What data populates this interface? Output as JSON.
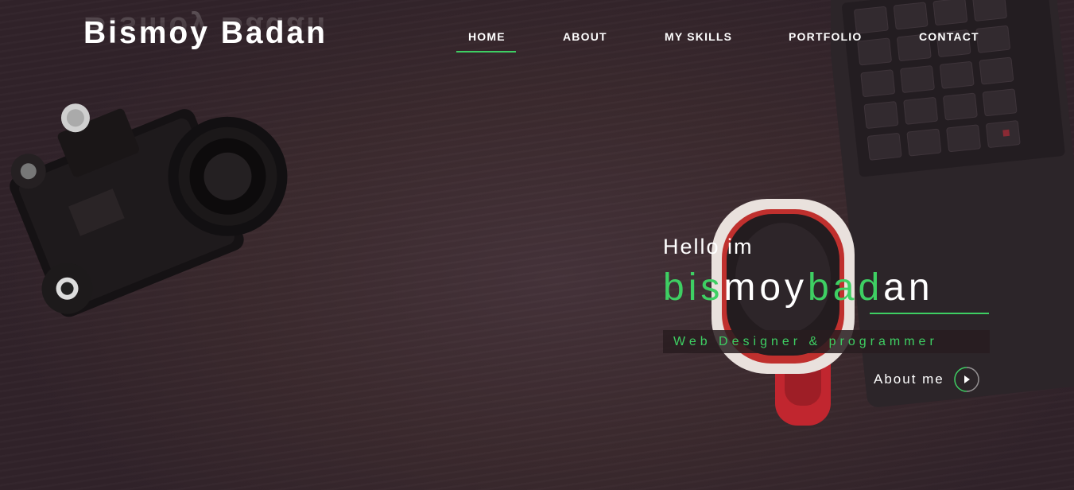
{
  "brand": {
    "name": "Bismoy Badan",
    "reflection": "Bismoy Badan"
  },
  "nav": {
    "items": [
      {
        "label": "HOME",
        "active": true
      },
      {
        "label": "ABOUT",
        "active": false
      },
      {
        "label": "MY SKILLS",
        "active": false
      },
      {
        "label": "PORTFOLIO",
        "active": false
      },
      {
        "label": "CONTACT",
        "active": false
      }
    ]
  },
  "hero": {
    "greeting": "Hello im",
    "name_parts": [
      {
        "text": "bis",
        "color": "green"
      },
      {
        "text": "moy",
        "color": "white"
      },
      {
        "text": "bad",
        "color": "green"
      },
      {
        "text": "an",
        "color": "white"
      }
    ],
    "role": "Web Designer & programmer",
    "cta_label": "About me",
    "cta_icon": "play-arrow-icon"
  },
  "colors": {
    "accent": "#3ecf63",
    "text": "#ffffff",
    "background": "#3a2a2c"
  }
}
